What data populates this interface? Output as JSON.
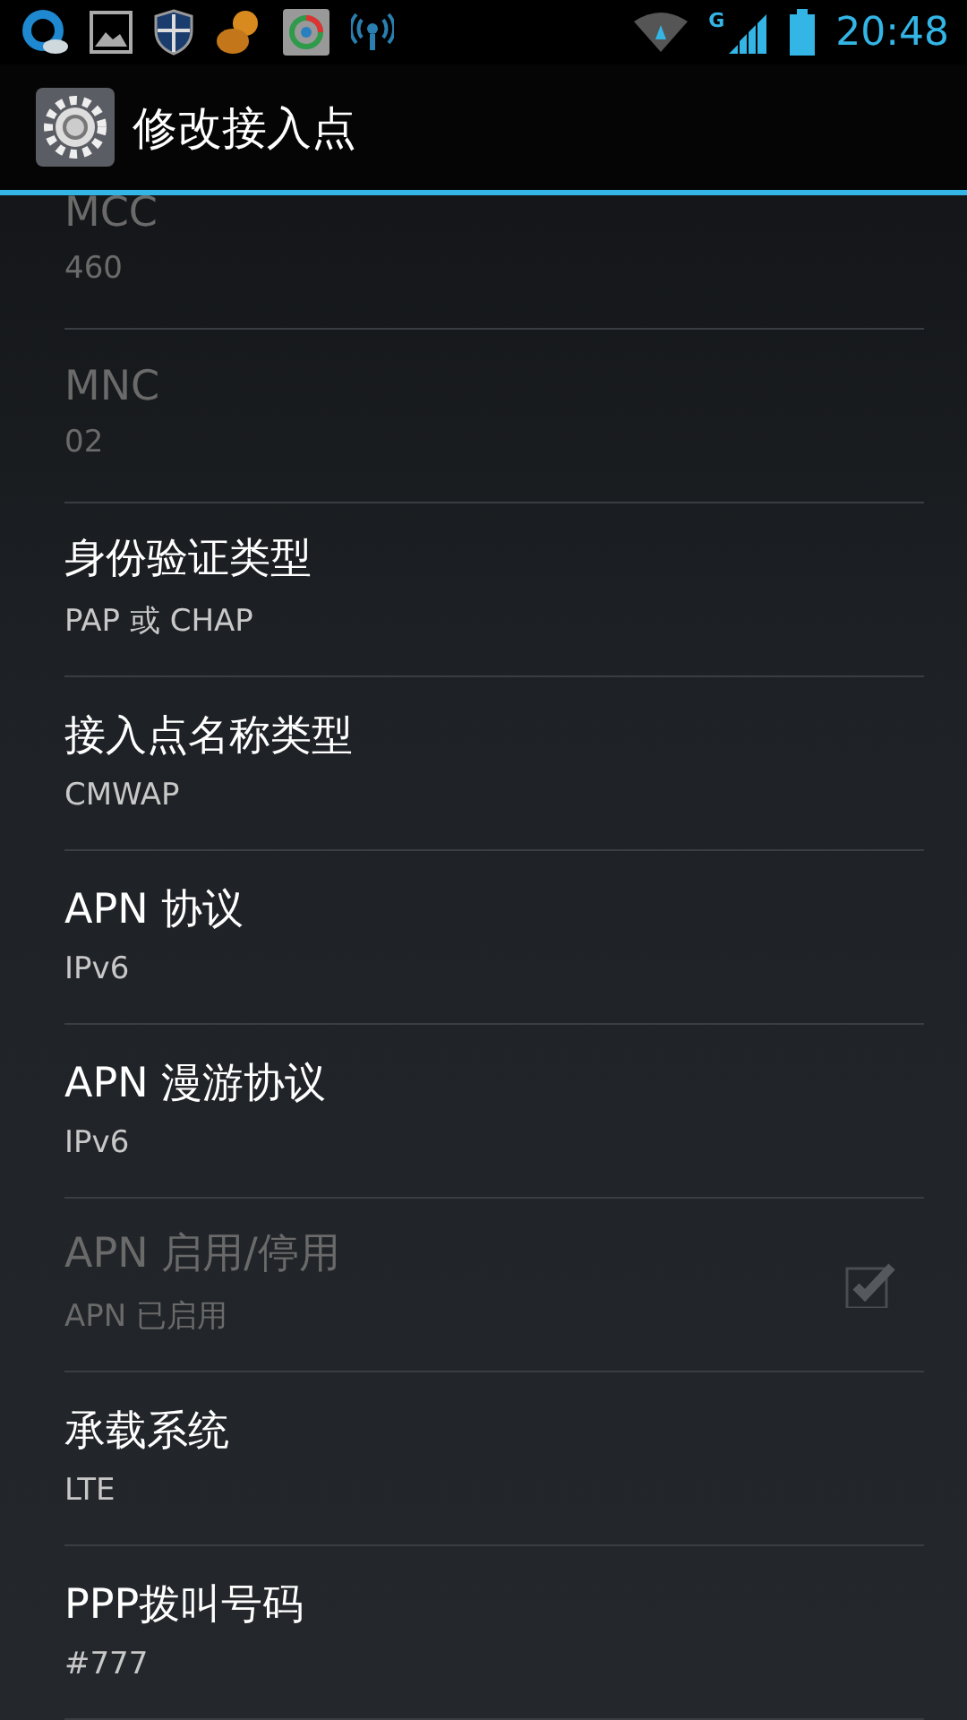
{
  "status_bar": {
    "network_type": "G",
    "time": "20:48"
  },
  "action_bar": {
    "title": "修改接入点"
  },
  "preferences": [
    {
      "kind": "text",
      "title": "MCC",
      "summary": "460",
      "disabled": true
    },
    {
      "kind": "text",
      "title": "MNC",
      "summary": "02",
      "disabled": true
    },
    {
      "kind": "text",
      "title": "身份验证类型",
      "summary": "PAP 或 CHAP",
      "disabled": false
    },
    {
      "kind": "text",
      "title": "接入点名称类型",
      "summary": "CMWAP",
      "disabled": false
    },
    {
      "kind": "text",
      "title": "APN 协议",
      "summary": "IPv6",
      "disabled": false
    },
    {
      "kind": "text",
      "title": "APN 漫游协议",
      "summary": "IPv6",
      "disabled": false
    },
    {
      "kind": "checkbox",
      "title": "APN 启用/停用",
      "summary": "APN 已启用",
      "disabled": true,
      "checked": true
    },
    {
      "kind": "text",
      "title": "承载系统",
      "summary": "LTE",
      "disabled": false
    },
    {
      "kind": "text",
      "title": "PPP拨叫号码",
      "summary": "#777",
      "disabled": false
    }
  ]
}
